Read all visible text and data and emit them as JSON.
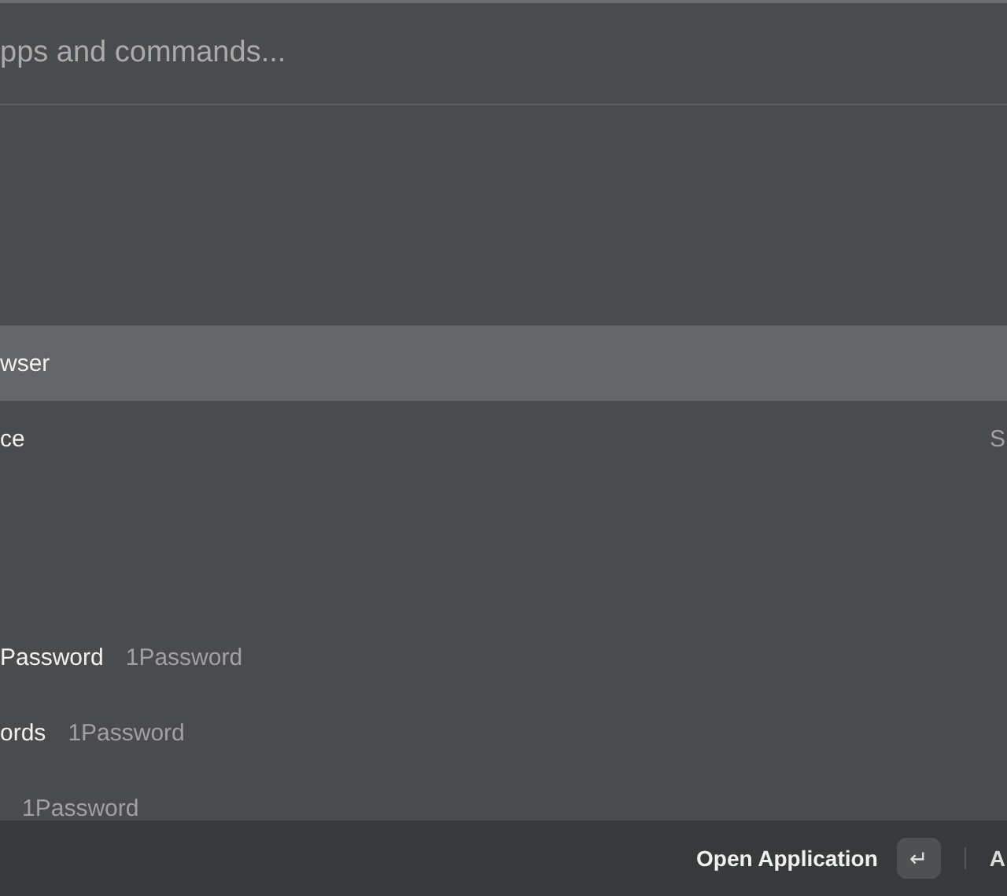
{
  "search": {
    "placeholder": "pps and commands..."
  },
  "results": [
    {
      "title": "wser",
      "selected": true
    },
    {
      "title": "ce",
      "accessory": "S",
      "selected": false
    }
  ],
  "password_results": [
    {
      "title": "Password",
      "subtitle": "1Password",
      "selected": false
    },
    {
      "title": "ords",
      "subtitle": "1Password",
      "selected": false
    },
    {
      "subtitle": "1Password",
      "selected": false
    }
  ],
  "footer": {
    "action": "Open Application",
    "key": "↵",
    "next": "A"
  }
}
